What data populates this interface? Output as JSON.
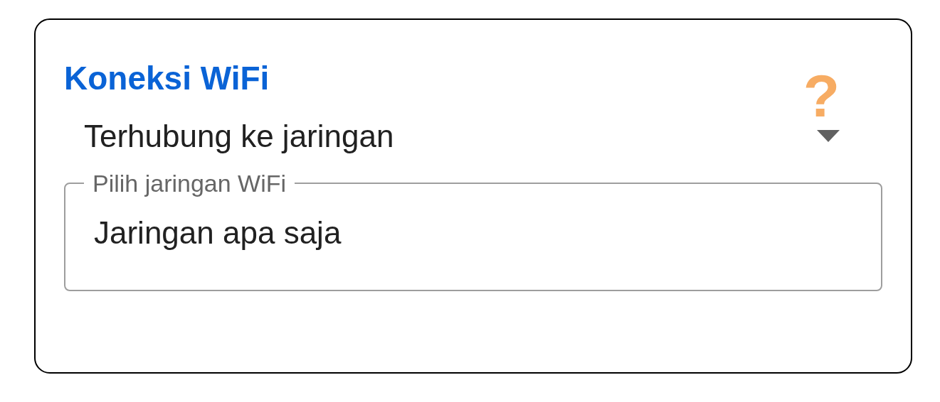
{
  "card": {
    "title": "Koneksi WiFi",
    "help": "?"
  },
  "dropdown": {
    "value": "Terhubung ke jaringan"
  },
  "network_field": {
    "label": "Pilih jaringan WiFi",
    "value": "Jaringan apa saja"
  }
}
